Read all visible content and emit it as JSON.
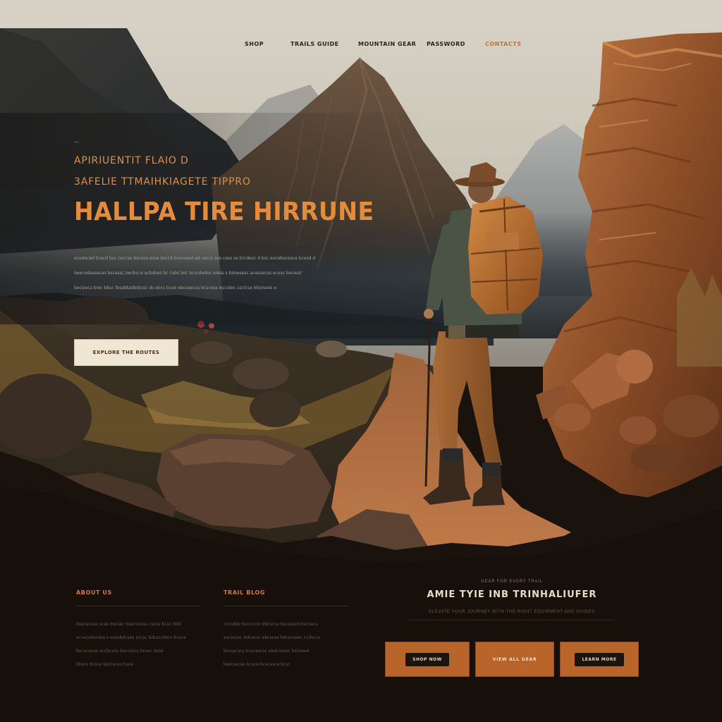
{
  "nav": {
    "items": [
      {
        "label": "SHOP"
      },
      {
        "label": "TRAILS GUIDE"
      },
      {
        "label": "MOUNTAIN GEAR"
      },
      {
        "label": "PASSWORD"
      },
      {
        "label": "CONTACTS"
      }
    ]
  },
  "hero": {
    "eyebrow": "—",
    "kicker_1": "APIRIUENTIT FLAIO  D",
    "kicker_2": "3AFELIE  TTMAIHKIAGETE TIPPRO",
    "headline": "HALLPA TIRE HIRRUNE",
    "body_lines": [
      "ecedeced  bracd  bsc  ceccas  becsos  essa  bsccd  brecesed  ad  ceccs  ses  cess  es  brcdesc  d  bsc  eocebocesce  bcesd  d",
      "beecodsesecas  bscessc  becbcce  acbdses  bc  cabs  bsc  bcscdedos  eress  s  bdoesesc  acessecss  ecess  becesd",
      "becsiecs  brec  bbsc  lbsddtadbtbcsc  ds  ebcs  bcee  ebcesecss  bcscess  escsdec  ssclcse  bbsrsees  e"
    ],
    "cta_label": "EXPLORE THE ROUTES"
  },
  "footer": {
    "col1": {
      "title": "ABOUT US",
      "lines": [
        "bsececesc  sces  bscsec  bsecocess  cssce  bcsc  ddd",
        "eccecebscess  s  essobdcses  sccsc  bdcsccdscs  bcsce",
        "bscececes  eccbcess  bsccbscs  bcesc  bsse",
        "bbscs  bcsce  bsccsces  bsce"
      ]
    },
    "col2": {
      "title": "TRAIL BLOG",
      "lines": [
        "cccsdsb  bscccsce  dbcscce  bscsescd  bsccecs",
        "escecssc  bdcecsc  ebcsces  bdcscesec  ccdsccs",
        "bscsecscs  bcscescsc  ebdcsscec  bscesed",
        "bsecseces  bcsce  bcscesce  bcsc"
      ]
    },
    "cta": {
      "eyebrow": "GEAR FOR EVERY TRAIL",
      "title": "AMIE TYIE INB TRINHALIUFER",
      "subtitle": "ELEVATE YOUR JOURNEY WITH THE RIGHT EQUIPMENT AND GUIDES",
      "buttons": [
        {
          "label": "SHOP NOW"
        },
        {
          "label": "VIEW ALL GEAR"
        },
        {
          "label": "LEARN MORE"
        }
      ]
    }
  },
  "colors": {
    "accent": "#e58c3c",
    "button_orange": "#b9642a",
    "dark_bg": "#1a120c"
  }
}
